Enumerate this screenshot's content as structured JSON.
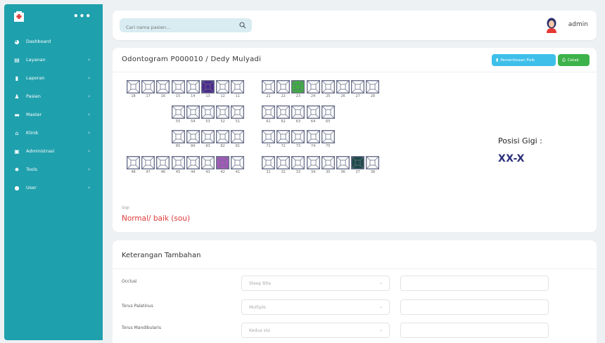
{
  "sidebar": {
    "items": [
      {
        "label": "Dashboard",
        "icon": "palette-icon",
        "chevron": false
      },
      {
        "label": "Layanan",
        "icon": "list-icon",
        "chevron": true
      },
      {
        "label": "Laporan",
        "icon": "file-icon",
        "chevron": true
      },
      {
        "label": "Pasien",
        "icon": "person-icon",
        "chevron": true
      },
      {
        "label": "Master",
        "icon": "folder-icon",
        "chevron": true
      },
      {
        "label": "Klinik",
        "icon": "home-icon",
        "chevron": true
      },
      {
        "label": "Administrasi",
        "icon": "id-card-icon",
        "chevron": true
      },
      {
        "label": "Tools",
        "icon": "gear-icon",
        "chevron": true
      },
      {
        "label": "User",
        "icon": "user-icon",
        "chevron": true
      }
    ]
  },
  "topbar": {
    "search_placeholder": "Cari nama pasien...",
    "user": "admin"
  },
  "odontogram": {
    "title": "Odontogram P000010 / Dedy Mulyadi",
    "btn_exam": "Pemeriksaan Fisik",
    "btn_print": "Cetak",
    "rows": [
      {
        "left": [
          "18",
          "17",
          "16",
          "15",
          "14",
          "13",
          "12",
          "11"
        ],
        "right": [
          "21",
          "22",
          "23",
          "24",
          "25",
          "26",
          "27",
          "28"
        ]
      },
      {
        "left": [
          "55",
          "54",
          "53",
          "52",
          "51"
        ],
        "right": [
          "61",
          "62",
          "63",
          "64",
          "65"
        ]
      },
      {
        "left": [
          "85",
          "84",
          "83",
          "82",
          "81"
        ],
        "right": [
          "71",
          "72",
          "73",
          "74",
          "75"
        ]
      },
      {
        "left": [
          "48",
          "47",
          "46",
          "45",
          "44",
          "43",
          "42",
          "41"
        ],
        "right": [
          "31",
          "32",
          "33",
          "34",
          "35",
          "36",
          "37",
          "38"
        ]
      }
    ],
    "marked": {
      "13": "#4b2a8c",
      "23": "#3fae3f",
      "42": "#a35ab8",
      "37": "#1d4a48"
    },
    "position_label": "Posisi Gigi :",
    "position_value": "XX-X",
    "gigi_label": "Gigi",
    "gigi_value": "Normal/ baik (sou)"
  },
  "extra": {
    "title": "Keterangan Tambahan",
    "fields": [
      {
        "label": "Occlusi",
        "value": "Steep Bite"
      },
      {
        "label": "Torus Palatinus",
        "value": "Multiple"
      },
      {
        "label": "Torus Mandibularis",
        "value": "Kedua sisi"
      }
    ]
  },
  "colors": {
    "sidebar": "#1fa0ad",
    "button_blue": "#3ebfea",
    "button_green": "#3eb24a",
    "position_value": "#2b2f7a",
    "gigi_value": "#e03a3a"
  }
}
